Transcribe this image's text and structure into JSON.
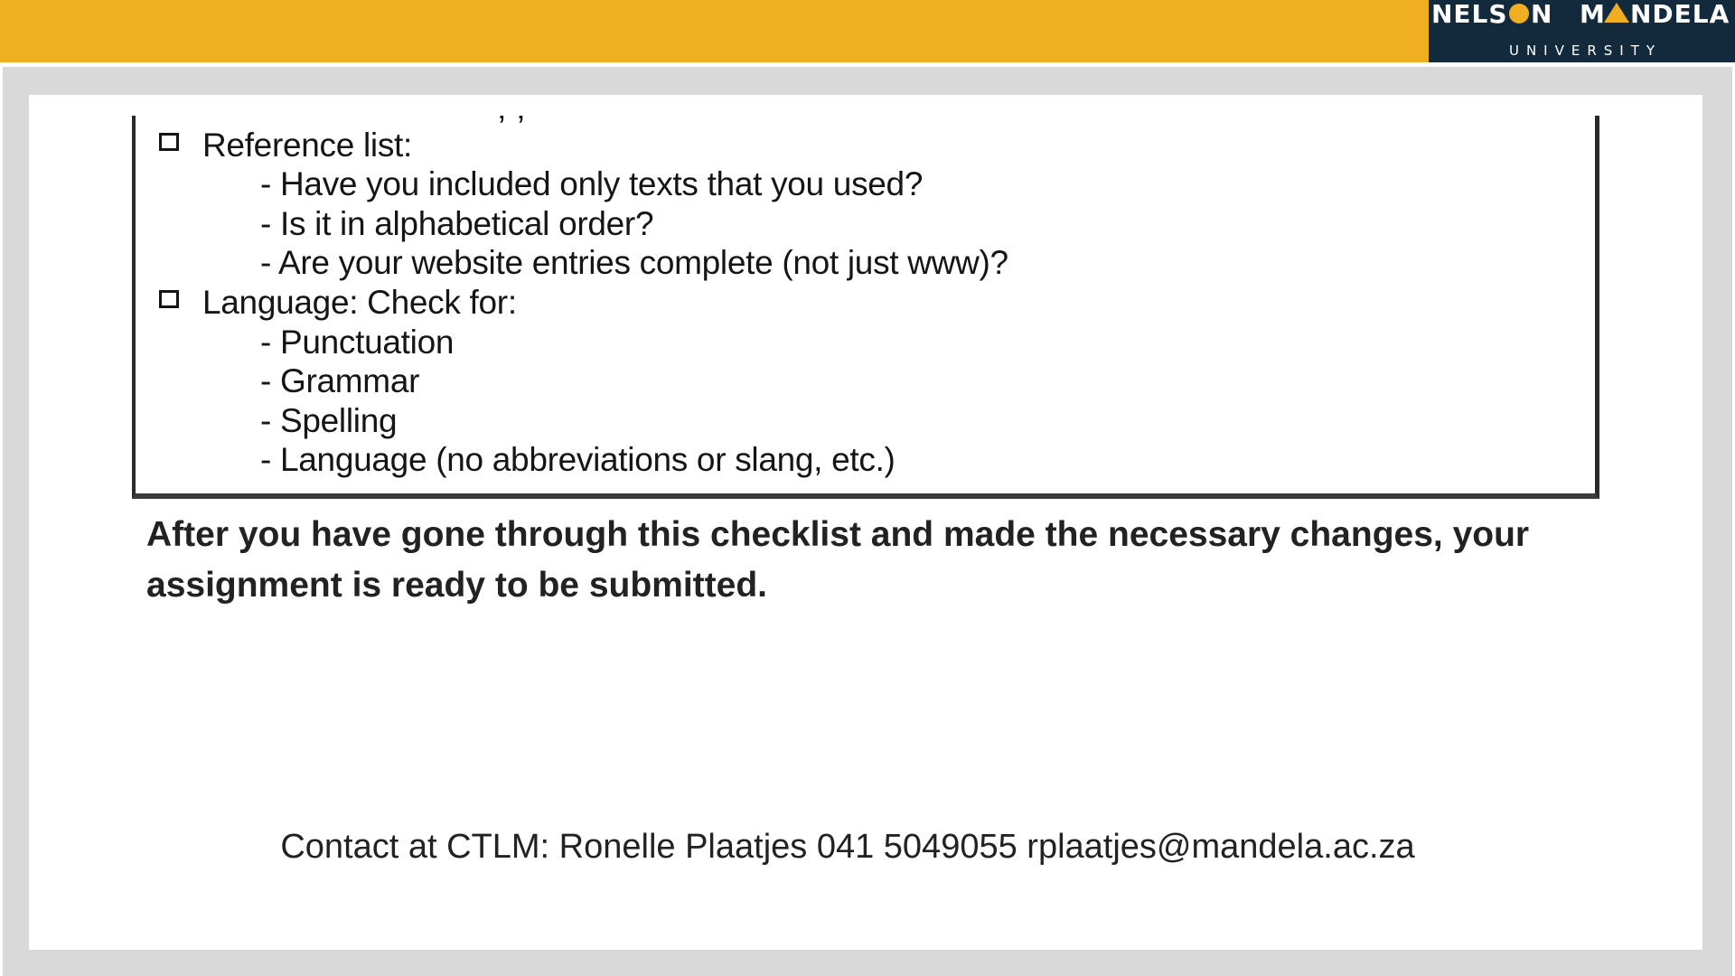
{
  "header": {
    "logo_main": "NELSON MANDELA",
    "logo_sub": "UNIVERSITY"
  },
  "checklist": {
    "items": [
      {
        "label": "Reference list:",
        "sub": [
          "- Have you included only texts that you used?",
          "- Is it in alphabetical order?",
          "- Are your website entries complete (not just www)?"
        ]
      },
      {
        "label": "Language: Check for:",
        "sub": [
          "- Punctuation",
          "- Grammar",
          "- Spelling",
          "- Language (no abbreviations or slang, etc.)"
        ]
      }
    ]
  },
  "closing_text": "After you have gone through this checklist and made the necessary changes, your assignment is ready to be submitted.",
  "contact_text": "Contact at CTLM: Ronelle Plaatjes 041 5049055 rplaatjes@mandela.ac.za",
  "colors": {
    "header_bar": "#f0ae21",
    "logo_background": "#132a3d",
    "frame": "#d9d9d9"
  }
}
